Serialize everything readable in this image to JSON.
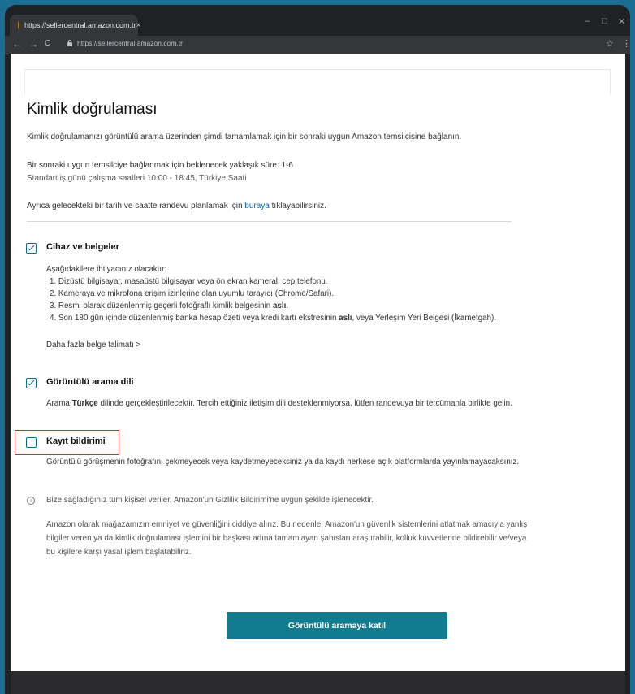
{
  "browser": {
    "tab_title": "https://sellercentral.amazon.com.tr",
    "tab_close": "×",
    "url": "https://sellercentral.amazon.com.tr",
    "min": "–",
    "max": "□",
    "close": "✕",
    "back": "←",
    "forward": "→",
    "reload": "C",
    "star": "☆",
    "menu": "⋮"
  },
  "page": {
    "title": "Kimlik doğrulaması",
    "intro": "Kimlik doğrulamanızı görüntülü arama üzerinden şimdi tamamlamak için bir sonraki uygun Amazon temsilcisine bağlanın.",
    "wait_time": "Bir sonraki uygun temsilciye bağlanmak için beklenecek yaklaşık süre: 1-6",
    "hours": "Standart iş günü çalışma saatleri 10:00 - 18:45, Türkiye Saati",
    "schedule_pre": "Ayrıca gelecekteki bir tarih ve saatte randevu planlamak için ",
    "schedule_link": "buraya",
    "schedule_post": " tıklayabilirsiniz."
  },
  "sections": {
    "devices": {
      "heading": "Cihaz ve belgeler",
      "checked": true,
      "need": "Aşağıdakilere ihtiyacınız olacaktır:",
      "item1": "1. Dizüstü bilgisayar, masaüstü bilgisayar veya ön ekran kameralı cep telefonu.",
      "item2": "2. Kameraya ve mikrofona erişim izinlerine olan uyumlu tarayıcı (Chrome/Safari).",
      "item3_pre": "3. Resmi olarak düzenlenmiş geçerli fotoğraflı kimlik belgesinin ",
      "item3_bold": "aslı",
      "item3_post": ".",
      "item4_pre": "4. Son 180 gün içinde düzenlenmiş banka hesap özeti veya kredi kartı ekstresinin ",
      "item4_bold": "aslı",
      "item4_post": ", veya Yerleşim Yeri Belgesi (İkametgah).",
      "more_link": "Daha fazla belge talimatı >"
    },
    "language": {
      "heading": "Görüntülü arama dili",
      "checked": true,
      "text_pre": "Arama ",
      "text_bold": "Türkçe",
      "text_post": " dilinde gerçekleştirilecektir. Tercih ettiğiniz iletişim dili desteklenmiyorsa, lütfen randevuya bir tercümanla birlikte gelin."
    },
    "recording": {
      "heading": "Kayıt bildirimi",
      "checked": false,
      "text": "Görüntülü görüşmenin fotoğrafını çekmeyecek veya kaydetmeyeceksiniz ya da kaydı herkese açık platformlarda yayınlamayacaksınız."
    }
  },
  "privacy": {
    "icon": "i",
    "notice": "Bize sağladığınız tüm kişisel veriler, Amazon'un Gizlilik Bildirimi'ne uygun şekilde işlenecektir.",
    "line1": "Amazon olarak mağazamızın emniyet ve güvenliğini ciddiye alırız. Bu nedenle, Amazon'un güvenlik sistemlerini atlatmak amacıyla yanlış",
    "line2": "bilgiler veren ya da kimlik doğrulaması işlemini bir başkası adına tamamlayan şahısları araştırabilir, kolluk kuvvetlerine bildirebilir ve/veya",
    "line3": "bu kişilere karşı yasal işlem başlatabiliriz."
  },
  "action": {
    "join_button": "Görüntülü aramaya katıl"
  },
  "colors": {
    "frame": "#202124",
    "accent": "#127c8f",
    "link": "#0066c0",
    "highlight_border": "#d62a2a"
  }
}
